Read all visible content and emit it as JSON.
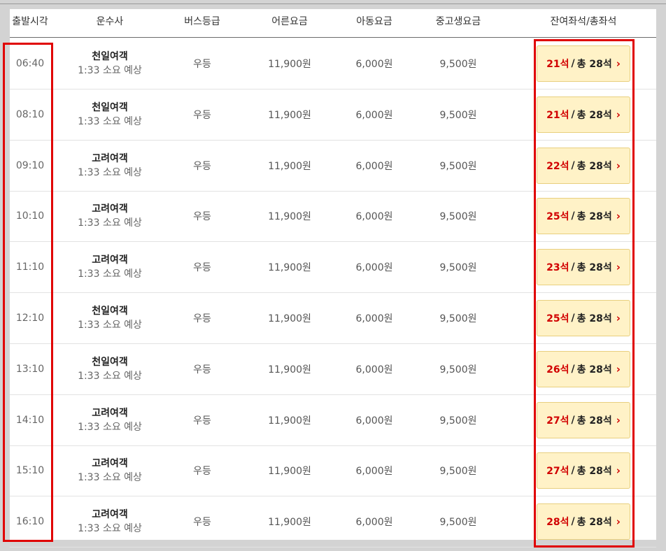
{
  "headers": {
    "departure": "출발시각",
    "company": "운수사",
    "grade": "버스등급",
    "adult": "어른요금",
    "child": "아동요금",
    "student": "중고생요금",
    "seats": "잔여좌석/총좌석"
  },
  "rows": [
    {
      "time": "06:40",
      "company": "천일여객",
      "duration": "1:33 소요 예상",
      "grade": "우등",
      "adult": "11,900원",
      "child": "6,000원",
      "student": "9,500원",
      "remain": "21석",
      "total": "총 28석"
    },
    {
      "time": "08:10",
      "company": "천일여객",
      "duration": "1:33 소요 예상",
      "grade": "우등",
      "adult": "11,900원",
      "child": "6,000원",
      "student": "9,500원",
      "remain": "21석",
      "total": "총 28석"
    },
    {
      "time": "09:10",
      "company": "고려여객",
      "duration": "1:33 소요 예상",
      "grade": "우등",
      "adult": "11,900원",
      "child": "6,000원",
      "student": "9,500원",
      "remain": "22석",
      "total": "총 28석"
    },
    {
      "time": "10:10",
      "company": "고려여객",
      "duration": "1:33 소요 예상",
      "grade": "우등",
      "adult": "11,900원",
      "child": "6,000원",
      "student": "9,500원",
      "remain": "25석",
      "total": "총 28석"
    },
    {
      "time": "11:10",
      "company": "고려여객",
      "duration": "1:33 소요 예상",
      "grade": "우등",
      "adult": "11,900원",
      "child": "6,000원",
      "student": "9,500원",
      "remain": "23석",
      "total": "총 28석"
    },
    {
      "time": "12:10",
      "company": "천일여객",
      "duration": "1:33 소요 예상",
      "grade": "우등",
      "adult": "11,900원",
      "child": "6,000원",
      "student": "9,500원",
      "remain": "25석",
      "total": "총 28석"
    },
    {
      "time": "13:10",
      "company": "천일여객",
      "duration": "1:33 소요 예상",
      "grade": "우등",
      "adult": "11,900원",
      "child": "6,000원",
      "student": "9,500원",
      "remain": "26석",
      "total": "총 28석"
    },
    {
      "time": "14:10",
      "company": "고려여객",
      "duration": "1:33 소요 예상",
      "grade": "우등",
      "adult": "11,900원",
      "child": "6,000원",
      "student": "9,500원",
      "remain": "27석",
      "total": "총 28석"
    },
    {
      "time": "15:10",
      "company": "고려여객",
      "duration": "1:33 소요 예상",
      "grade": "우등",
      "adult": "11,900원",
      "child": "6,000원",
      "student": "9,500원",
      "remain": "27석",
      "total": "총 28석"
    },
    {
      "time": "16:10",
      "company": "고려여객",
      "duration": "1:33 소요 예상",
      "grade": "우등",
      "adult": "11,900원",
      "child": "6,000원",
      "student": "9,500원",
      "remain": "28석",
      "total": "총 28석"
    }
  ],
  "seat_separator": "/",
  "chevron": "›",
  "colors": {
    "accent_red": "#d10000",
    "button_bg": "#fff2c7",
    "highlight_border": "#e00000"
  }
}
